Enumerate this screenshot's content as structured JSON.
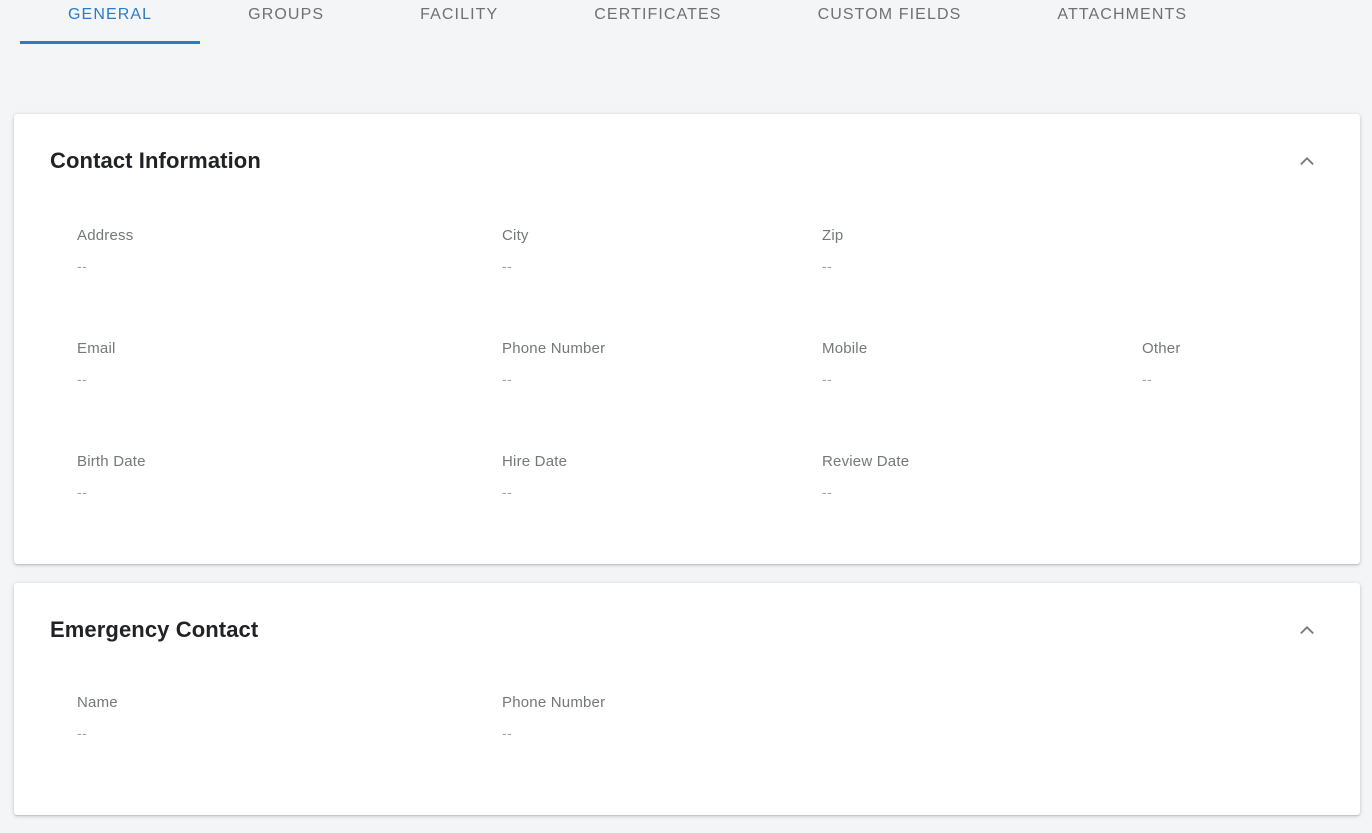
{
  "colors": {
    "accent": "#2d7cc3",
    "page_background": "#f4f5f7",
    "card_background": "#ffffff"
  },
  "tabs": {
    "items": [
      {
        "label": "GENERAL",
        "active": true
      },
      {
        "label": "GROUPS",
        "active": false
      },
      {
        "label": "FACILITY",
        "active": false
      },
      {
        "label": "CERTIFICATES",
        "active": false
      },
      {
        "label": "CUSTOM FIELDS",
        "active": false
      },
      {
        "label": "ATTACHMENTS",
        "active": false
      }
    ]
  },
  "contact_information": {
    "title": "Contact Information",
    "collapse_icon": "chevron-up-icon",
    "fields": {
      "address": {
        "label": "Address",
        "value": "--"
      },
      "city": {
        "label": "City",
        "value": "--"
      },
      "zip": {
        "label": "Zip",
        "value": "--"
      },
      "email": {
        "label": "Email",
        "value": "--"
      },
      "phone_number": {
        "label": "Phone Number",
        "value": "--"
      },
      "mobile": {
        "label": "Mobile",
        "value": "--"
      },
      "other": {
        "label": "Other",
        "value": "--"
      },
      "birth_date": {
        "label": "Birth Date",
        "value": "--"
      },
      "hire_date": {
        "label": "Hire Date",
        "value": "--"
      },
      "review_date": {
        "label": "Review Date",
        "value": "--"
      }
    }
  },
  "emergency_contact": {
    "title": "Emergency Contact",
    "collapse_icon": "chevron-up-icon",
    "fields": {
      "name": {
        "label": "Name",
        "value": "--"
      },
      "phone_number": {
        "label": "Phone Number",
        "value": "--"
      }
    }
  }
}
